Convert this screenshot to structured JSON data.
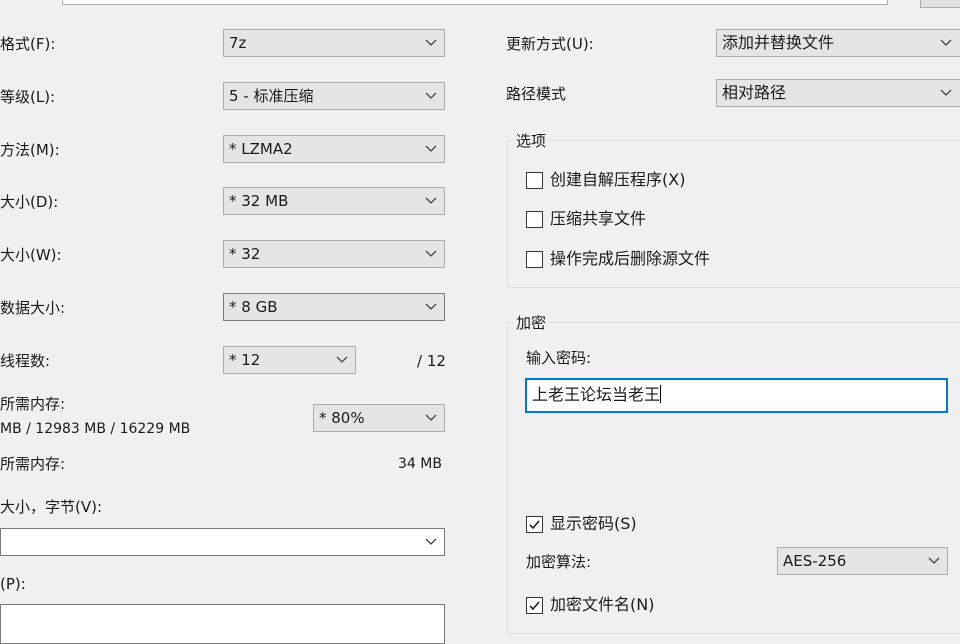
{
  "left": {
    "format": {
      "label": "格式(F):",
      "value": "7z"
    },
    "level": {
      "label": "等级(L):",
      "value": "5 - 标准压缩"
    },
    "method": {
      "label": "方法(M):",
      "value": "* LZMA2"
    },
    "dict": {
      "label": "大小(D):",
      "value": "* 32 MB"
    },
    "word": {
      "label": "大小(W):",
      "value": "* 32"
    },
    "solid": {
      "label": "数据大小:",
      "value": "* 8 GB"
    },
    "threads": {
      "label": "线程数:",
      "value": "* 12",
      "max": "/ 12"
    },
    "mem_compress": {
      "label": "所需内存:",
      "detail": "MB / 12983 MB / 16229 MB",
      "value": "* 80%"
    },
    "mem_decompress": {
      "label": "所需内存:",
      "value": "34 MB"
    },
    "split": {
      "label": "大小，字节(V):",
      "value": ""
    },
    "params": {
      "label": "(P):",
      "value": ""
    }
  },
  "right": {
    "update": {
      "label": "更新方式(U):",
      "value": "添加并替换文件"
    },
    "pathmode": {
      "label": "路径模式",
      "value": "相对路径"
    },
    "options": {
      "title": "选项",
      "sfx": {
        "label": "创建自解压程序(X)",
        "checked": false
      },
      "shared": {
        "label": "压缩共享文件",
        "checked": false
      },
      "delete": {
        "label": "操作完成后删除源文件",
        "checked": false
      }
    },
    "encryption": {
      "title": "加密",
      "pw_label": "输入密码:",
      "pw_value": "上老王论坛当老王",
      "show_pw": {
        "label": "显示密码(S)",
        "checked": true
      },
      "method_label": "加密算法:",
      "method_value": "AES-256",
      "encrypt_names": {
        "label": "加密文件名(N)",
        "checked": true
      }
    }
  }
}
